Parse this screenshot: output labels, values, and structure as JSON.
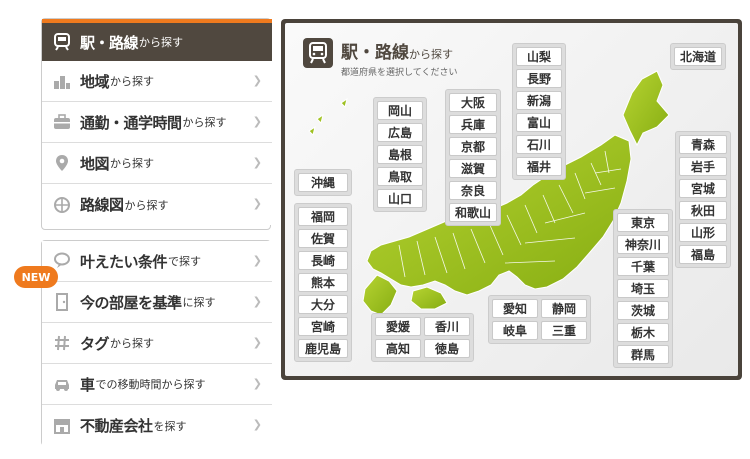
{
  "menu": {
    "items": [
      {
        "id": "station",
        "main": "駅・路線",
        "sub": "から探す",
        "icon": "train-icon"
      },
      {
        "id": "area",
        "main": "地域",
        "sub": "から探す",
        "icon": "building-icon"
      },
      {
        "id": "commute",
        "main": "通勤・通学時間",
        "sub": "から探す",
        "icon": "briefcase-icon"
      },
      {
        "id": "mapsearch",
        "main": "地図",
        "sub": "から探す",
        "icon": "map-pin-icon"
      },
      {
        "id": "route",
        "main": "路線図",
        "sub": "から探す",
        "icon": "route-map-icon"
      },
      {
        "id": "conditions",
        "main": "叶えたい条件",
        "sub": "で探す",
        "icon": "balloon-icon"
      },
      {
        "id": "room",
        "main": "今の部屋を基準",
        "sub": "に探す",
        "icon": "door-icon"
      },
      {
        "id": "tag",
        "main": "タグ",
        "sub": "から探す",
        "icon": "hash-icon"
      },
      {
        "id": "car",
        "main": "車",
        "sub": "での移動時間から探す",
        "icon": "car-icon"
      },
      {
        "id": "agency",
        "main": "不動産会社",
        "sub": "を探す",
        "icon": "shop-icon"
      }
    ],
    "new_badge": "NEW"
  },
  "map": {
    "title_main": "駅・路線",
    "title_sub": "から探す",
    "subtitle": "都道府県を選択してください",
    "regions": {
      "hokkaido": [
        "北海道"
      ],
      "tohoku": [
        "青森",
        "岩手",
        "宮城",
        "秋田",
        "山形",
        "福島"
      ],
      "kanto": [
        "東京",
        "神奈川",
        "千葉",
        "埼玉",
        "茨城",
        "栃木",
        "群馬"
      ],
      "koshinetsu": [
        "山梨",
        "長野",
        "新潟",
        "富山",
        "石川",
        "福井"
      ],
      "kinki": [
        "大阪",
        "兵庫",
        "京都",
        "滋賀",
        "奈良",
        "和歌山"
      ],
      "chugoku": [
        "岡山",
        "広島",
        "島根",
        "鳥取",
        "山口"
      ],
      "okinawa": [
        "沖縄"
      ],
      "kyushu": [
        "福岡",
        "佐賀",
        "長崎",
        "熊本",
        "大分",
        "宮崎",
        "鹿児島"
      ],
      "shikoku": [
        "愛媛",
        "香川",
        "高知",
        "徳島"
      ],
      "tokai": [
        "愛知",
        "静岡",
        "岐阜",
        "三重"
      ]
    }
  }
}
